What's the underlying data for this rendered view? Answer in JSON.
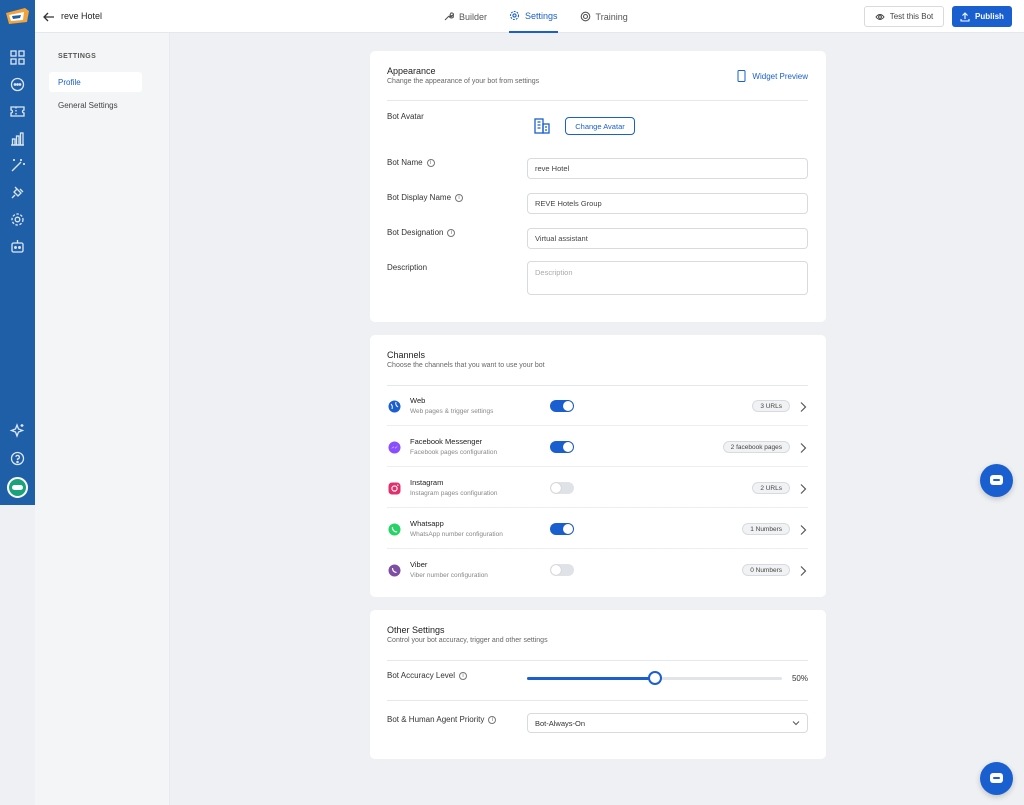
{
  "header": {
    "bot_title": "reve Hotel",
    "tabs": [
      {
        "label": "Builder",
        "icon": "wrench-icon"
      },
      {
        "label": "Settings",
        "icon": "gear-icon",
        "active": true
      },
      {
        "label": "Training",
        "icon": "target-icon"
      }
    ],
    "test_label": "Test this Bot",
    "publish_label": "Publish"
  },
  "sidebar": {
    "heading": "SETTINGS",
    "items": [
      {
        "label": "Profile",
        "active": true
      },
      {
        "label": "General Settings"
      }
    ]
  },
  "appearance": {
    "title": "Appearance",
    "subtitle": "Change the appearance of your bot from settings",
    "widget_preview": "Widget Preview",
    "avatar_label": "Bot Avatar",
    "change_avatar": "Change Avatar",
    "bot_name_label": "Bot Name",
    "bot_name_value": "reve Hotel",
    "display_name_label": "Bot Display Name",
    "display_name_value": "REVE Hotels Group",
    "designation_label": "Bot Designation",
    "designation_value": "Virtual assistant",
    "description_label": "Description",
    "description_placeholder": "Description"
  },
  "channels": {
    "title": "Channels",
    "subtitle": "Choose the channels that you want to use your bot",
    "items": [
      {
        "name": "Web",
        "desc": "Web pages & trigger settings",
        "enabled": true,
        "count": "3 URLs",
        "icon": "globe-icon",
        "color": "#1a5fcf"
      },
      {
        "name": "Facebook Messenger",
        "desc": "Facebook pages configuration",
        "enabled": true,
        "count": "2 facebook pages",
        "icon": "messenger-icon",
        "color": "#8a4dff"
      },
      {
        "name": "Instagram",
        "desc": "Instagram pages configuration",
        "enabled": false,
        "count": "2 URLs",
        "icon": "instagram-icon",
        "color": "#e1306c"
      },
      {
        "name": "Whatsapp",
        "desc": "WhatsApp number configuration",
        "enabled": true,
        "count": "1 Numbers",
        "icon": "whatsapp-icon",
        "color": "#25d366"
      },
      {
        "name": "Viber",
        "desc": "Viber number configuration",
        "enabled": false,
        "count": "0 Numbers",
        "icon": "viber-icon",
        "color": "#7d4ea3"
      }
    ]
  },
  "other": {
    "title": "Other Settings",
    "subtitle": "Control your bot accuracy, trigger and other settings",
    "accuracy_label": "Bot Accuracy Level",
    "accuracy_value": 0.5,
    "accuracy_text": "50%",
    "priority_label": "Bot & Human Agent Priority",
    "priority_value": "Bot-Always-On"
  },
  "colors": {
    "accent": "#1a5fcf",
    "rail": "#1f5fa8"
  }
}
